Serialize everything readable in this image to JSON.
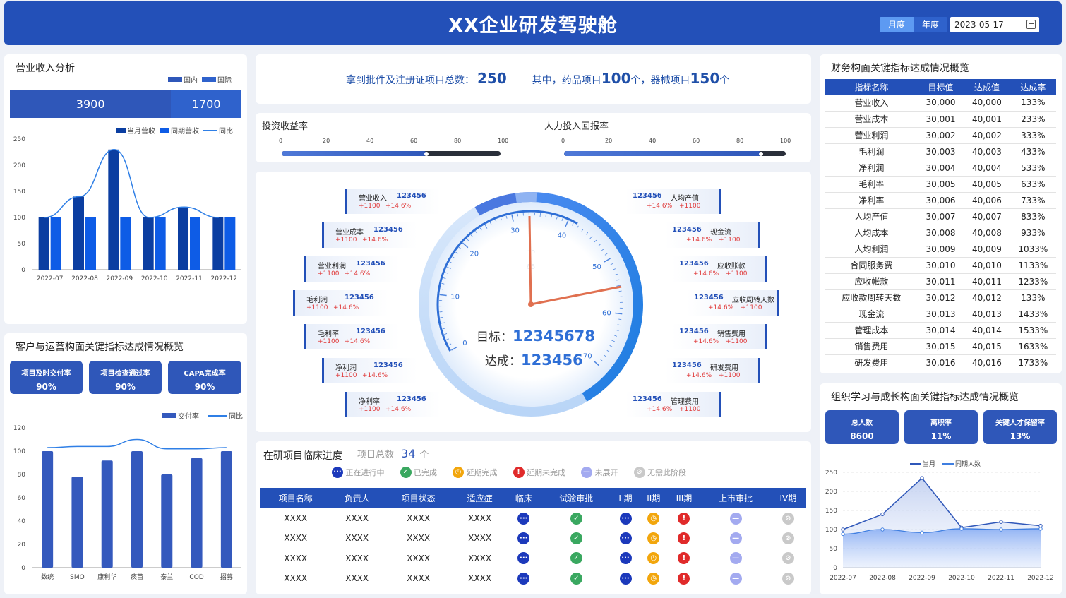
{
  "header": {
    "title": "XX企业研发驾驶舱",
    "toggle_month": "月度",
    "toggle_year": "年度",
    "date": "2023-05-17"
  },
  "revenue": {
    "title": "营业收入分析",
    "legend": [
      "国内",
      "国际"
    ],
    "domestic_value": "3900",
    "intl_value": "1700",
    "domestic_share": 0.696,
    "chart_legend": [
      "当月营收",
      "同期营收",
      "同比"
    ]
  },
  "customer": {
    "title": "客户与运营构面关键指标达成情况概览",
    "kpis": [
      {
        "label": "项目及时交付率",
        "value": "90%"
      },
      {
        "label": "项目检查通过率",
        "value": "90%"
      },
      {
        "label": "CAPA完成率",
        "value": "90%"
      }
    ],
    "chart_legend": [
      "交付率",
      "同比"
    ]
  },
  "approval": {
    "label": "拿到批件及注册证项目总数：",
    "total": "250",
    "t1": "其中，药品项目",
    "drug": "100",
    "t2": "个，器械项目",
    "device": "150",
    "t3": "个"
  },
  "roi": {
    "label": "投资收益率",
    "ticks": [
      "0",
      "20",
      "40",
      "60",
      "80",
      "100"
    ],
    "value": 66
  },
  "hr": {
    "label": "人力投入回报率",
    "ticks": [
      "0",
      "20",
      "40",
      "60",
      "80",
      "100"
    ],
    "value": 89
  },
  "gauge": {
    "ticks": [
      "0",
      "10",
      "20",
      "30",
      "40",
      "50",
      "60",
      "70"
    ],
    "faint_ticks": [
      "35",
      "65"
    ],
    "target_label": "目标：",
    "target": "12345678",
    "achieve_label": "达成：",
    "achieve": "123456"
  },
  "metrics_left": [
    {
      "name": "营业收入",
      "value": "123456",
      "d1": "+1100",
      "d2": "+14.6%"
    },
    {
      "name": "营业成本",
      "value": "123456",
      "d1": "+1100",
      "d2": "+14.6%"
    },
    {
      "name": "营业利润",
      "value": "123456",
      "d1": "+1100",
      "d2": "+14.6%"
    },
    {
      "name": "毛利润",
      "value": "123456",
      "d1": "+1100",
      "d2": "+14.6%"
    },
    {
      "name": "毛利率",
      "value": "123456",
      "d1": "+1100",
      "d2": "+14.6%"
    },
    {
      "name": "净利润",
      "value": "123456",
      "d1": "+1100",
      "d2": "+14.6%"
    },
    {
      "name": "净利率",
      "value": "123456",
      "d1": "+1100",
      "d2": "+14.6%"
    }
  ],
  "metrics_right": [
    {
      "name": "人均产值",
      "value": "123456",
      "d1": "+14.6%",
      "d2": "+1100"
    },
    {
      "name": "现金流",
      "value": "123456",
      "d1": "+14.6%",
      "d2": "+1100"
    },
    {
      "name": "应收账款",
      "value": "123456",
      "d1": "+14.6%",
      "d2": "+1100"
    },
    {
      "name": "应收周转天数",
      "value": "123456",
      "d1": "+14.6%",
      "d2": "+1100"
    },
    {
      "name": "销售费用",
      "value": "123456",
      "d1": "+14.6%",
      "d2": "+1100"
    },
    {
      "name": "研发费用",
      "value": "123456",
      "d1": "+14.6%",
      "d2": "+1100"
    },
    {
      "name": "管理费用",
      "value": "123456",
      "d1": "+14.6%",
      "d2": "+1100"
    }
  ],
  "projects": {
    "title": "在研项目临床进度",
    "total_label": "项目总数",
    "total": "34",
    "unit": "个",
    "legend": [
      "正在进行中",
      "已完成",
      "延期完成",
      "延期未完成",
      "未展开",
      "无需此阶段"
    ],
    "headers": [
      "项目名称",
      "负责人",
      "项目状态",
      "适应症",
      "临床",
      "试验审批",
      "I 期",
      "II期",
      "III期",
      "上市审批",
      "IV期"
    ],
    "rows": [
      [
        "XXXX",
        "XXXX",
        "XXXX",
        "XXXX"
      ],
      [
        "XXXX",
        "XXXX",
        "XXXX",
        "XXXX"
      ],
      [
        "XXXX",
        "XXXX",
        "XXXX",
        "XXXX"
      ],
      [
        "XXXX",
        "XXXX",
        "XXXX",
        "XXXX"
      ]
    ]
  },
  "finance": {
    "title": "财务构面关键指标达成情况概览",
    "headers": [
      "指标名称",
      "目标值",
      "达成值",
      "达成率"
    ],
    "rows": [
      [
        "营业收入",
        "30,000",
        "40,000",
        "133%"
      ],
      [
        "营业成本",
        "30,001",
        "40,001",
        "233%"
      ],
      [
        "营业利润",
        "30,002",
        "40,002",
        "333%"
      ],
      [
        "毛利润",
        "30,003",
        "40,003",
        "433%"
      ],
      [
        "净利润",
        "30,004",
        "40,004",
        "533%"
      ],
      [
        "毛利率",
        "30,005",
        "40,005",
        "633%"
      ],
      [
        "净利率",
        "30,006",
        "40,006",
        "733%"
      ],
      [
        "人均产值",
        "30,007",
        "40,007",
        "833%"
      ],
      [
        "人均成本",
        "30,008",
        "40,008",
        "933%"
      ],
      [
        "人均利润",
        "30,009",
        "40,009",
        "1033%"
      ],
      [
        "合同服务费",
        "30,010",
        "40,010",
        "1133%"
      ],
      [
        "应收帐款",
        "30,011",
        "40,011",
        "1233%"
      ],
      [
        "应收款周转天数",
        "30,012",
        "40,012",
        "133%"
      ],
      [
        "现金流",
        "30,013",
        "40,013",
        "1433%"
      ],
      [
        "管理成本",
        "30,014",
        "40,014",
        "1533%"
      ],
      [
        "销售费用",
        "30,015",
        "40,015",
        "1633%"
      ],
      [
        "研发费用",
        "30,016",
        "40,016",
        "1733%"
      ]
    ]
  },
  "learning": {
    "title": "组织学习与成长构面关键指标达成情况概览",
    "kpis": [
      {
        "label": "总人数",
        "value": "8600"
      },
      {
        "label": "离职率",
        "value": "11%"
      },
      {
        "label": "关键人才保留率",
        "value": "13%"
      }
    ],
    "chart_legend": [
      "当月",
      "同期人数"
    ]
  },
  "chart_data": [
    {
      "type": "bar",
      "categories": [
        "2022-07",
        "2022-08",
        "2022-09",
        "2022-10",
        "2022-11",
        "2022-12"
      ],
      "series": [
        {
          "name": "当月营收",
          "values": [
            100,
            140,
            230,
            100,
            120,
            100
          ]
        },
        {
          "name": "同期营收",
          "values": [
            100,
            100,
            100,
            100,
            100,
            100
          ]
        },
        {
          "name": "同比",
          "type": "line",
          "values": [
            100,
            140,
            230,
            100,
            120,
            100
          ]
        }
      ],
      "ylim": [
        0,
        250
      ],
      "yticks": [
        0,
        50,
        100,
        150,
        200,
        250
      ]
    },
    {
      "type": "bar",
      "categories": [
        "数统",
        "SMO",
        "康利华",
        "痰苗",
        "泰兰",
        "COD",
        "招募"
      ],
      "series": [
        {
          "name": "交付率",
          "values": [
            100,
            78,
            92,
            100,
            80,
            94,
            100
          ]
        },
        {
          "name": "同比",
          "type": "line",
          "values": [
            103,
            104,
            104,
            110,
            102,
            102,
            103
          ]
        }
      ],
      "ylim": [
        0,
        120
      ],
      "yticks": [
        0,
        20,
        40,
        60,
        80,
        100,
        120
      ]
    },
    {
      "type": "area",
      "categories": [
        "2022-07",
        "2022-08",
        "2022-09",
        "2022-10",
        "2022-11",
        "2022-12"
      ],
      "series": [
        {
          "name": "当月",
          "values": [
            100,
            140,
            235,
            105,
            120,
            110
          ]
        },
        {
          "name": "同期人数",
          "values": [
            88,
            100,
            92,
            102,
            100,
            102
          ]
        }
      ],
      "ylim": [
        0,
        250
      ],
      "yticks": [
        0,
        50,
        100,
        150,
        200,
        250
      ]
    }
  ],
  "colors": {
    "primary": "#2350b8",
    "dark_bar": "#0b3ea1",
    "bright_bar": "#0e5ce6",
    "red": "#e03a3a"
  }
}
